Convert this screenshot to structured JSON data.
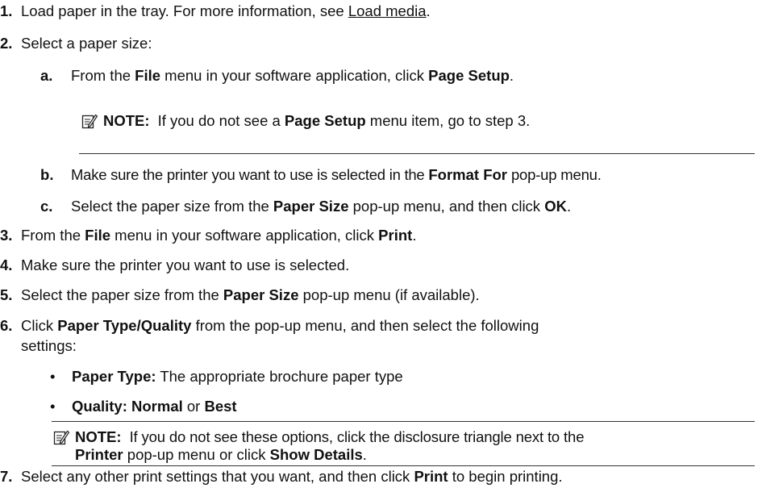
{
  "steps": {
    "s1": {
      "num": "1.",
      "pre": "Load paper in the tray. For more information, see ",
      "link": "Load media",
      "post": "."
    },
    "s2": {
      "num": "2.",
      "text": "Select a paper size:"
    },
    "s2a": {
      "letter": "a",
      "dot": ".",
      "t1": "From the ",
      "b1": "File",
      "t2": " menu in your software application, click ",
      "b2": "Page Setup",
      "t3": "."
    },
    "note1": {
      "label": "NOTE:",
      "t1": "If you do not see a ",
      "b1": "Page Setup",
      "t2": " menu item, go to step 3."
    },
    "s2b": {
      "letter": "b",
      "dot": ".",
      "t1": "Make sure the printer you want to use is selected in the ",
      "b1": "Format For",
      "t2": " pop-up menu."
    },
    "s2c": {
      "letter": "c",
      "dot": ".",
      "t1": "Select the paper size from the ",
      "b1": "Paper Size",
      "t2": " pop-up menu, and then click ",
      "b2": "OK",
      "t3": "."
    },
    "s3": {
      "num": "3.",
      "t1": "From the ",
      "b1": "File",
      "t2": " menu in your software application, click ",
      "b2": "Print",
      "t3": "."
    },
    "s4": {
      "num": "4.",
      "text": "Make sure the printer you want to use is selected."
    },
    "s5": {
      "num": "5.",
      "t1": "Select the paper size from the ",
      "b1": "Paper Size",
      "t2": " pop-up menu (if available)."
    },
    "s6": {
      "num": "6.",
      "t1": "Click ",
      "b1": "Paper Type/Quality",
      "t2": " from the pop-up menu, and then select the following",
      "cont": "settings:"
    },
    "bullet1": {
      "mark": "•",
      "b1": "Paper Type:",
      "t1": " The appropriate brochure paper type"
    },
    "bullet2": {
      "mark": "•",
      "b1": "Quality: Normal",
      "t1": " or ",
      "b2": "Best"
    },
    "note2": {
      "label": "NOTE:",
      "t1": "If you do not see these options, click the disclosure triangle next to the",
      "b1": "Printer",
      "t2": " pop-up menu or click ",
      "b2": "Show Details",
      "t3": "."
    },
    "s7": {
      "num": "7.",
      "t1": "Select any other print settings that you want, and then click ",
      "b1": "Print",
      "t2": " to begin printing."
    }
  },
  "icons": {
    "note": "note-pencil-icon"
  }
}
